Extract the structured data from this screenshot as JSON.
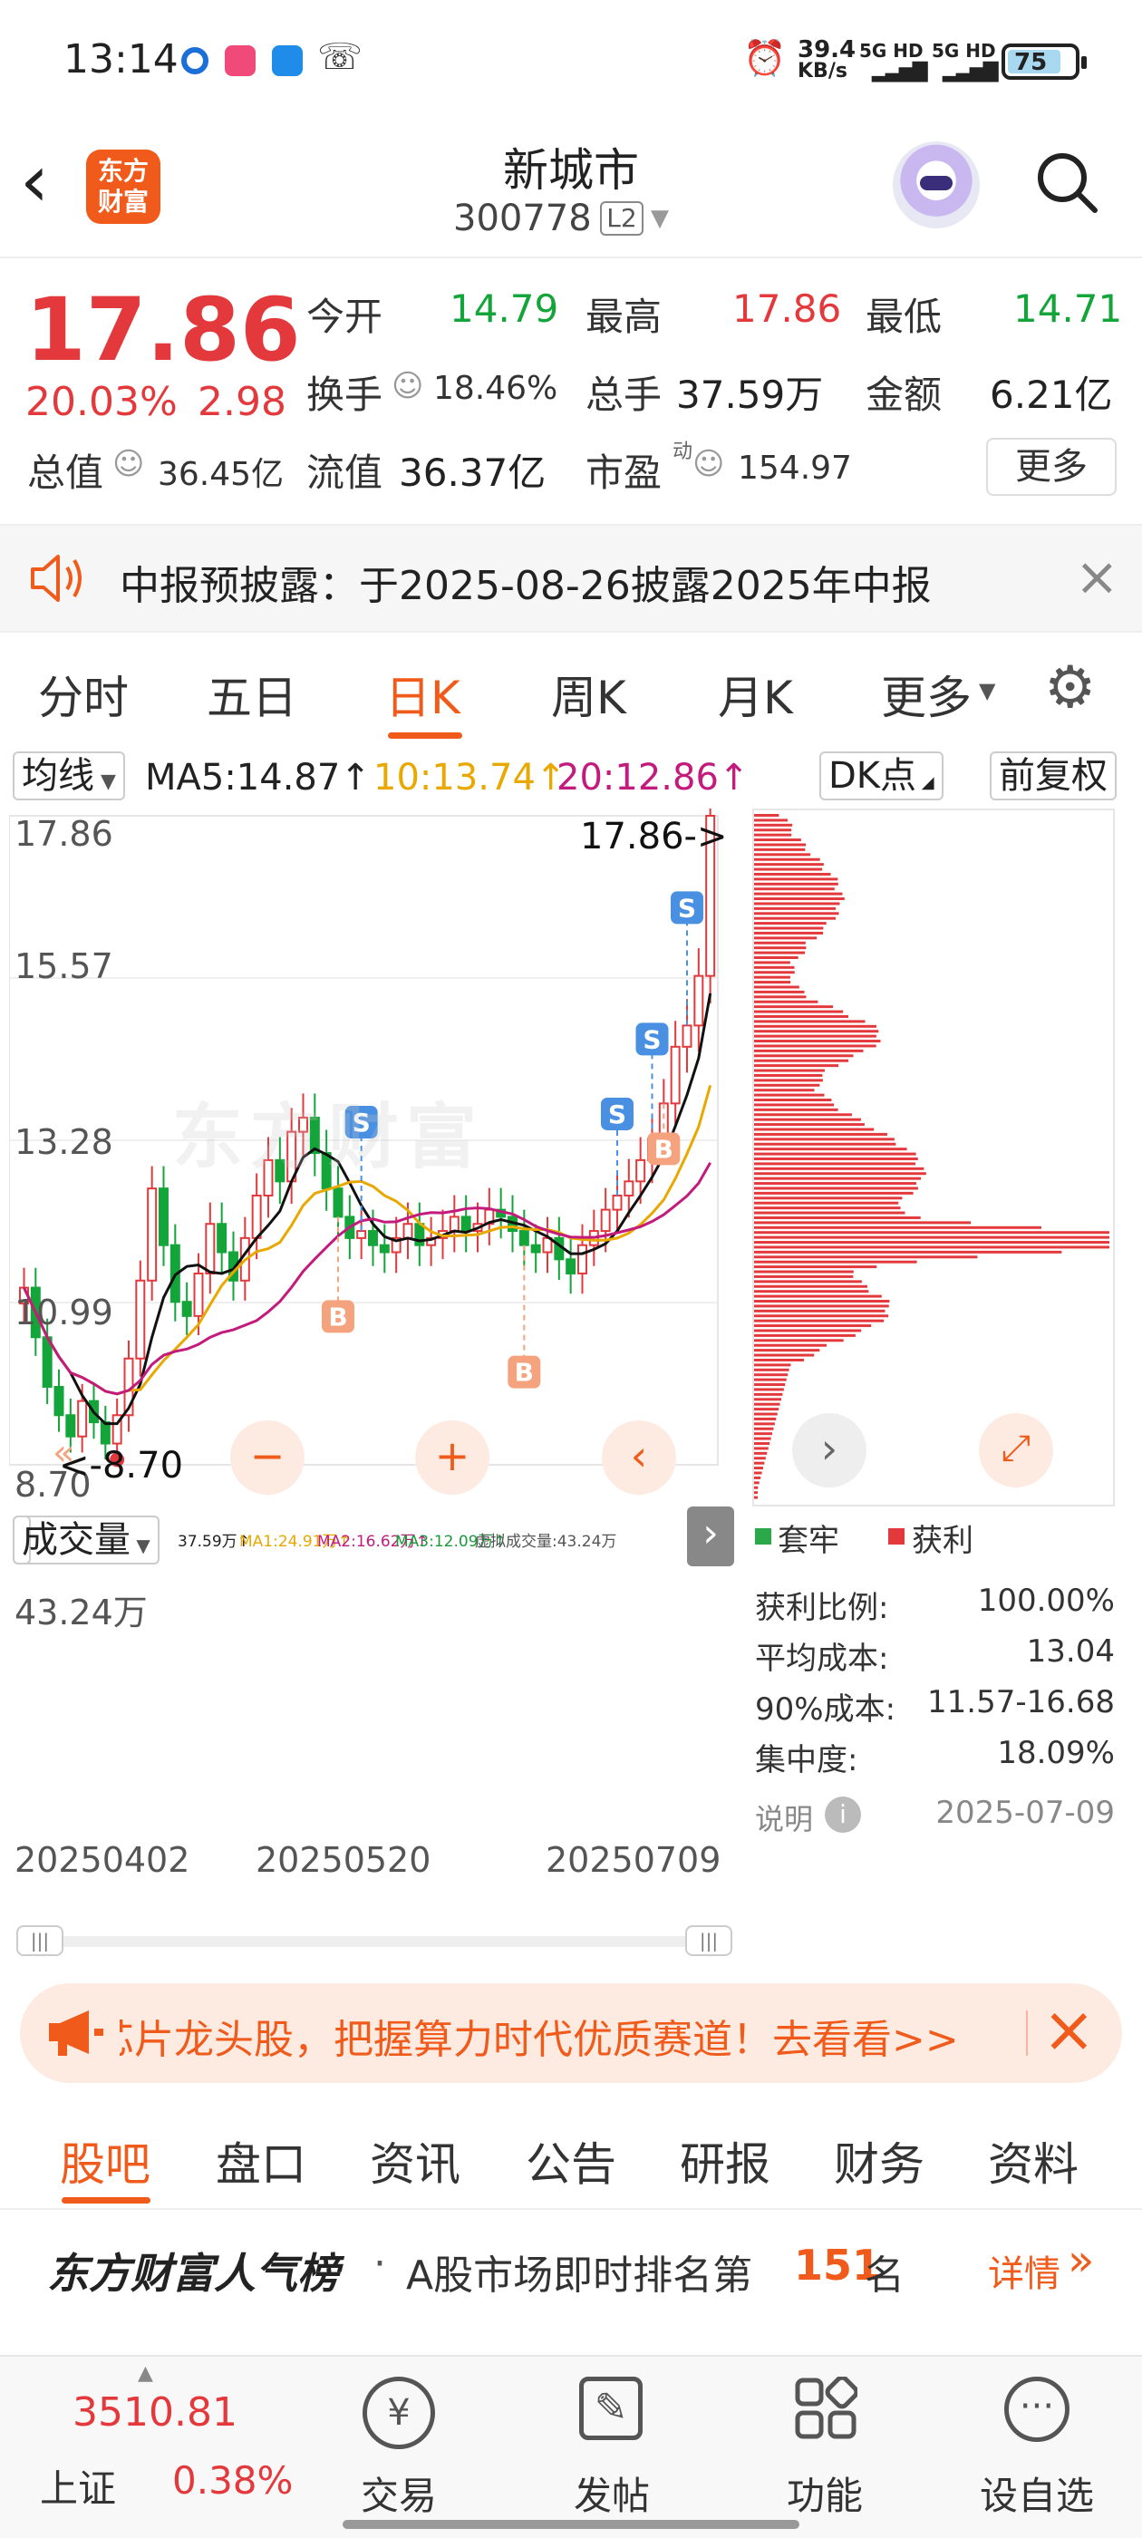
{
  "status_bar": {
    "time": "13:14",
    "net_speed": "39.4",
    "net_unit": "KB/s",
    "sig1": "5G HD",
    "sig2": "5G HD",
    "battery": "75"
  },
  "header": {
    "logo_line1": "东方",
    "logo_line2": "财富",
    "title": "新城市",
    "code": "300778",
    "level": "L2"
  },
  "quote": {
    "price": "17.86",
    "pct": "20.03%",
    "change": "2.98",
    "open_label": "今开",
    "open": "14.79",
    "high_label": "最高",
    "high": "17.86",
    "low_label": "最低",
    "low": "14.71",
    "turnover_label": "换手",
    "turnover": "18.46%",
    "volume_label": "总手",
    "volume": "37.59万",
    "amount_label": "金额",
    "amount": "6.21亿",
    "mktcap_label": "总值",
    "mktcap": "36.45亿",
    "float_label": "流值",
    "float": "36.37亿",
    "pe_label": "市盈",
    "pe_sup": "动",
    "pe": "154.97",
    "more": "更多"
  },
  "notice": {
    "text": "中报预披露：于2025-08-26披露2025年中报"
  },
  "tabs": [
    "分时",
    "五日",
    "日K",
    "周K",
    "月K",
    "更多"
  ],
  "indicator": {
    "ma_btn": "均线",
    "ma5": "MA5:14.87↑",
    "ma10": "10:13.74↑",
    "ma20": "20:12.86↑",
    "dk_btn": "DK点",
    "fq_btn": "前复权",
    "ma10_color": "#e8a800",
    "ma20_color": "#c21b7c"
  },
  "kchart": {
    "y_top": "17.86",
    "y_2": "15.57",
    "y_3": "13.28",
    "y_4": "10.99",
    "y_bottom": "8.70",
    "high_label": "17.86->",
    "low_label": "<-8.70",
    "watermark": "东方财富"
  },
  "volume_bar": {
    "btn": "成交量",
    "vol": "37.59万↑",
    "ma1": "MA1:24.91万↑",
    "ma2": "MA2:16.62万↑",
    "ma3": "MA3:12.09万↑",
    "virtual": "虚拟成交量:43.24万",
    "ymax": "43.24万"
  },
  "dates": [
    "20250402",
    "20250520",
    "20250709"
  ],
  "chip": {
    "legend_trapped": "套牢",
    "legend_profit": "获利",
    "rows": [
      {
        "label": "获利比例:",
        "value": "100.00%"
      },
      {
        "label": "平均成本:",
        "value": "13.04"
      },
      {
        "label": "90%成本:",
        "value": "11.57-16.68"
      },
      {
        "label": "集中度:",
        "value": "18.09%"
      }
    ],
    "note": "说明",
    "date": "2025-07-09"
  },
  "banner": {
    "text": "芯片龙头股，把握算力时代优质赛道！去看看>>"
  },
  "subtabs": [
    "股吧",
    "盘口",
    "资讯",
    "公告",
    "研报",
    "财务",
    "资料"
  ],
  "popularity": {
    "brand": "东方财富人气榜",
    "text_pre": "A股市场即时排名第",
    "rank": "151",
    "text_post": "名",
    "detail": "详情"
  },
  "bottom_nav": {
    "index_value": "3510.81",
    "index_name": "上证",
    "index_pct": "0.38%",
    "items": [
      "交易",
      "发帖",
      "功能",
      "设自选"
    ]
  },
  "chart_data": {
    "type": "candlestick",
    "title": "日K",
    "y_ticks": [
      17.86,
      15.57,
      13.28,
      10.99,
      8.7
    ],
    "ylim": [
      8.7,
      17.86
    ],
    "x_ticks": [
      "20250402",
      "20250520",
      "20250709"
    ],
    "close_series": [
      11.2,
      10.5,
      9.8,
      9.4,
      9.1,
      9.6,
      9.3,
      9.0,
      9.4,
      10.2,
      11.3,
      12.6,
      11.8,
      11.0,
      10.8,
      11.4,
      12.1,
      11.7,
      11.3,
      11.9,
      12.5,
      13.0,
      12.7,
      13.4,
      13.6,
      13.1,
      12.6,
      12.2,
      11.9,
      12.0,
      11.8,
      11.7,
      11.9,
      12.1,
      11.8,
      11.9,
      12.0,
      12.2,
      12.0,
      12.1,
      12.3,
      12.2,
      12.0,
      11.8,
      11.7,
      11.9,
      11.6,
      11.4,
      11.8,
      12.0,
      12.3,
      12.5,
      12.7,
      13.0,
      13.3,
      13.8,
      14.6,
      14.9,
      15.6,
      17.86
    ],
    "volume_ymax": "43.24万"
  }
}
